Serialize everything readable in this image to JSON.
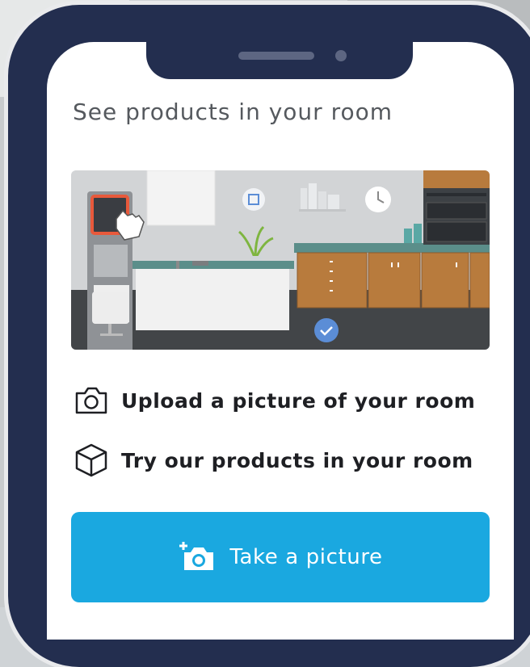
{
  "page": {
    "title": "See products in your room"
  },
  "steps": [
    {
      "label": "Upload a picture of your room",
      "icon": "camera-outline-icon"
    },
    {
      "label": "Try our products in your room",
      "icon": "cube-outline-icon"
    }
  ],
  "cta": {
    "label": "Take a picture",
    "icon": "add-photo-icon"
  },
  "colors": {
    "phone_frame": "#232e4f",
    "cta_background": "#1aa8e0",
    "cta_text": "#ffffff",
    "title_text": "#55595e"
  }
}
